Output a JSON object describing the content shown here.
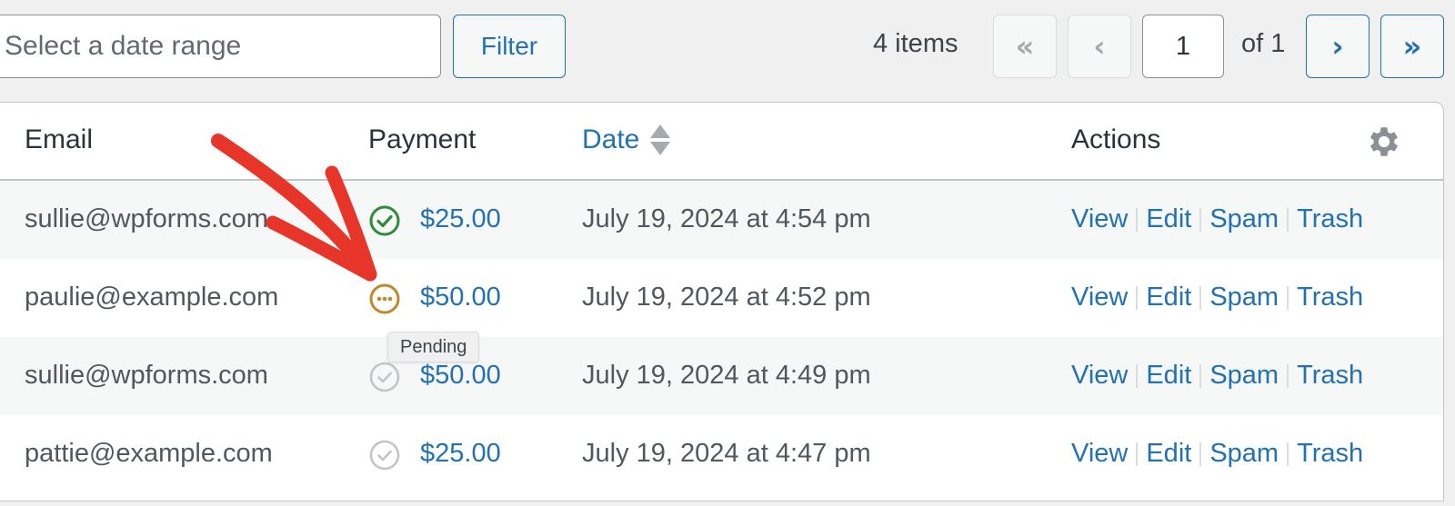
{
  "toolbar": {
    "date_range_placeholder": "Select a date range",
    "filter_label": "Filter"
  },
  "pagination": {
    "items_count": "4 items",
    "first_label": "«",
    "prev_label": "‹",
    "current_page": "1",
    "of_label": "of 1",
    "next_label": "›",
    "last_label": "»"
  },
  "table": {
    "columns": {
      "email": "Email",
      "payment": "Payment",
      "date": "Date",
      "actions": "Actions"
    },
    "rows": [
      {
        "email": "sullie@wpforms.com",
        "payment_status": "completed",
        "amount": "$25.00",
        "date": "July 19, 2024 at 4:54 pm"
      },
      {
        "email": "paulie@example.com",
        "payment_status": "pending",
        "amount": "$50.00",
        "date": "July 19, 2024 at 4:52 pm"
      },
      {
        "email": "sullie@wpforms.com",
        "payment_status": "not-applicable",
        "amount": "$50.00",
        "date": "July 19, 2024 at 4:49 pm"
      },
      {
        "email": "pattie@example.com",
        "payment_status": "not-applicable",
        "amount": "$25.00",
        "date": "July 19, 2024 at 4:47 pm"
      }
    ],
    "row_actions": {
      "view": "View",
      "edit": "Edit",
      "spam": "Spam",
      "trash": "Trash"
    }
  },
  "tooltip": {
    "text": "Pending"
  },
  "colors": {
    "accent": "#2271b1",
    "status_completed": "#2e8b3a",
    "status_pending": "#c08a2b",
    "status_inactive": "#c3c4c7",
    "annotation_arrow": "#e8352a"
  }
}
